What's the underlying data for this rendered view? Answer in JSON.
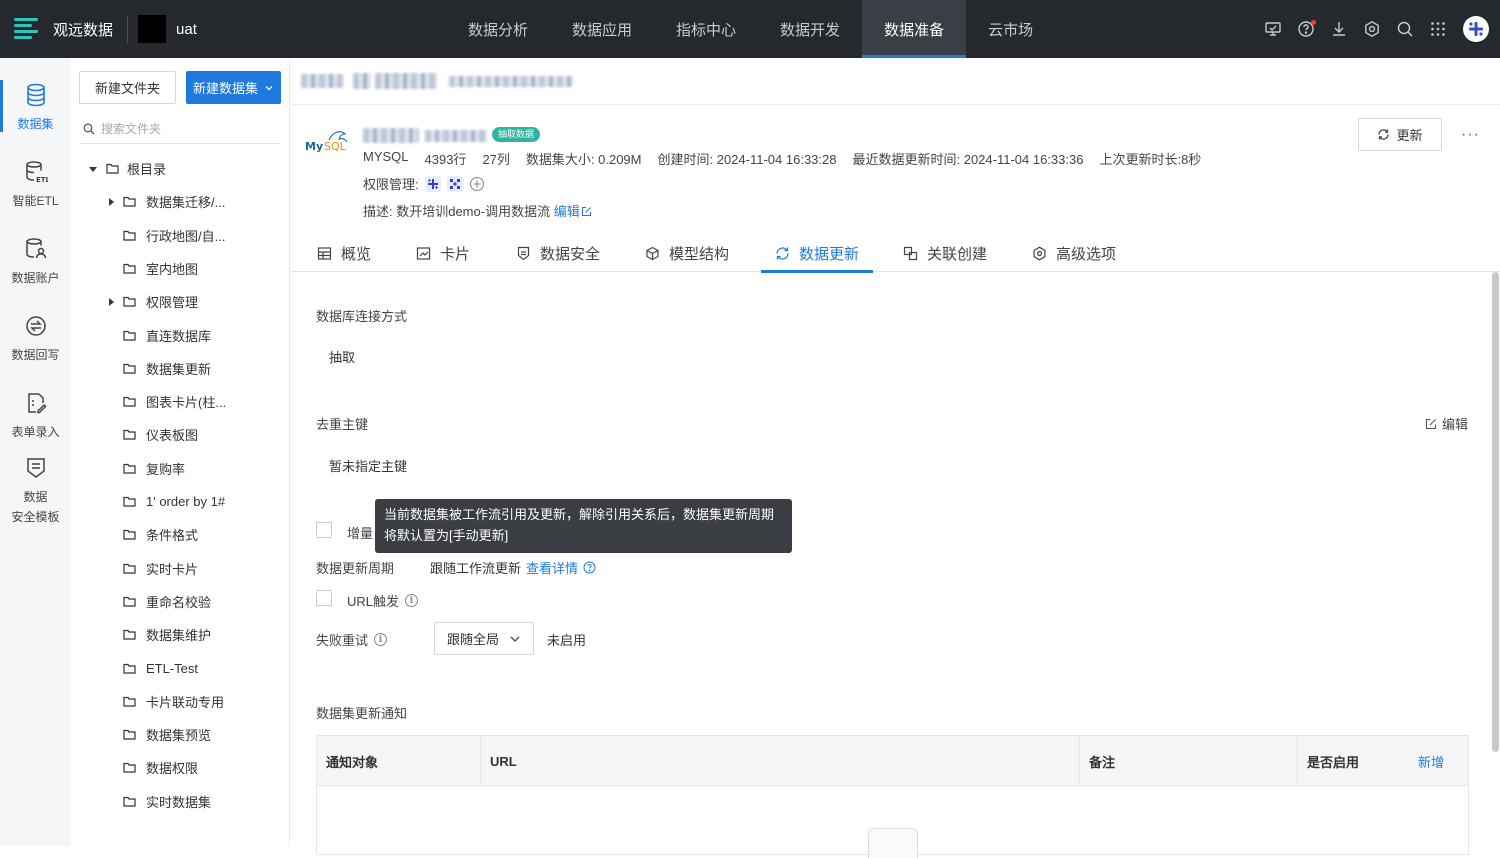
{
  "app": {
    "name": "观远数据",
    "project": "uat"
  },
  "nav": [
    "数据分析",
    "数据应用",
    "指标中心",
    "数据开发",
    "数据准备",
    "云市场"
  ],
  "nav_active": "数据准备",
  "rail": [
    {
      "label": "数据集",
      "icon": "database-icon"
    },
    {
      "label": "智能ETL",
      "icon": "etl-icon"
    },
    {
      "label": "数据账户",
      "icon": "data-account-icon"
    },
    {
      "label": "数据回写",
      "icon": "data-writeback-icon"
    },
    {
      "label": "表单录入",
      "icon": "form-entry-icon"
    },
    {
      "label": "数据安全模板",
      "line1": "数据",
      "line2": "安全模板",
      "icon": "security-template-icon"
    }
  ],
  "folder_panel": {
    "new_folder": "新建文件夹",
    "new_dataset": "新建数据集",
    "search_placeholder": "搜索文件夹",
    "root": "根目录",
    "items": [
      {
        "label": "数据集迁移/...",
        "expandable": true
      },
      {
        "label": "行政地图/自...",
        "expandable": false
      },
      {
        "label": "室内地图",
        "expandable": false
      },
      {
        "label": "权限管理",
        "expandable": true
      },
      {
        "label": "直连数据库",
        "expandable": false
      },
      {
        "label": "数据集更新",
        "expandable": false
      },
      {
        "label": "图表卡片(柱...",
        "expandable": false
      },
      {
        "label": "仪表板图",
        "expandable": false
      },
      {
        "label": "复购率",
        "expandable": false
      },
      {
        "label": "1' order by 1#",
        "expandable": false
      },
      {
        "label": "条件格式",
        "expandable": false
      },
      {
        "label": "实时卡片",
        "expandable": false
      },
      {
        "label": "重命名校验",
        "expandable": false
      },
      {
        "label": "数据集维护",
        "expandable": false
      },
      {
        "label": "ETL-Test",
        "expandable": false
      },
      {
        "label": "卡片联动专用",
        "expandable": false
      },
      {
        "label": "数据集预览",
        "expandable": false
      },
      {
        "label": "数据权限",
        "expandable": false
      },
      {
        "label": "实时数据集",
        "expandable": false
      }
    ]
  },
  "dataset": {
    "tag": "抽取数据",
    "source_type": "MYSQL",
    "rows": "4393行",
    "cols": "27列",
    "size": "数据集大小: 0.209M",
    "created": "创建时间: 2024-11-04 16:33:28",
    "last_update": "最近数据更新时间: 2024-11-04 16:33:36",
    "last_duration": "上次更新时长:8秒",
    "perm_label": "权限管理:",
    "desc_label": "描述: 数开培训demo-调用数据流",
    "desc_edit": "编辑",
    "refresh": "更新",
    "more": "···"
  },
  "tabs": [
    {
      "label": "概览",
      "icon": "table-icon"
    },
    {
      "label": "卡片",
      "icon": "chart-card-icon"
    },
    {
      "label": "数据安全",
      "icon": "shield-icon"
    },
    {
      "label": "模型结构",
      "icon": "cube-icon"
    },
    {
      "label": "数据更新",
      "icon": "refresh-icon"
    },
    {
      "label": "关联创建",
      "icon": "link-icon"
    },
    {
      "label": "高级选项",
      "icon": "gear-icon"
    }
  ],
  "tab_active": "数据更新",
  "update": {
    "conn_label": "数据库连接方式",
    "conn_value": "抽取",
    "dedup_label": "去重主键",
    "dedup_edit": "编辑",
    "dedup_value": "暂未指定主键",
    "incremental_label": "增量",
    "tooltip": "当前数据集被工作流引用及更新，解除引用关系后，数据集更新周期将默认置为[手动更新]",
    "period_label": "数据更新周期",
    "period_value": "跟随工作流更新",
    "period_link": "查看详情",
    "url_trigger": "URL触发",
    "retry_label": "失败重试",
    "retry_select": "跟随全局",
    "retry_status": "未启用",
    "notify_label": "数据集更新通知",
    "table_headers": [
      "通知对象",
      "URL",
      "备注",
      "是否启用"
    ],
    "table_add": "新增"
  },
  "colors": {
    "accent": "#1f7ae0",
    "topbar": "#25282d",
    "tag": "#2db3a0"
  }
}
